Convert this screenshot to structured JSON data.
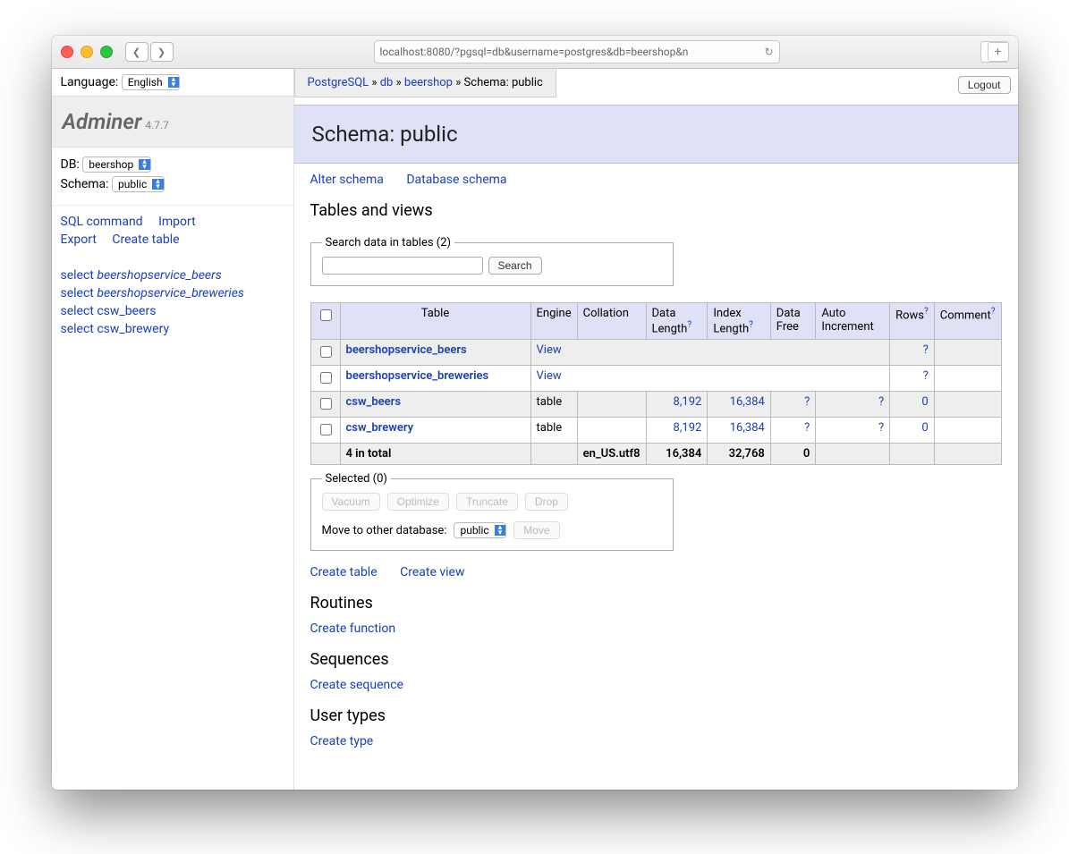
{
  "browser": {
    "url": "localhost:8080/?pgsql=db&username=postgres&db=beershop&n"
  },
  "sidebar": {
    "language_label": "Language:",
    "language_value": "English",
    "logo": "Adminer",
    "version": "4.7.7",
    "db_label": "DB:",
    "db_value": "beershop",
    "schema_label": "Schema:",
    "schema_value": "public",
    "links": {
      "sql": "SQL command",
      "import": "Import",
      "export": "Export",
      "create_table": "Create table"
    },
    "tablelinks": [
      {
        "pre": "select ",
        "name": "beershopservice_beers",
        "italic": true
      },
      {
        "pre": "select ",
        "name": "beershopservice_breweries",
        "italic": true
      },
      {
        "pre": "select ",
        "name": "csw_beers",
        "italic": false
      },
      {
        "pre": "select ",
        "name": "csw_brewery",
        "italic": false
      }
    ]
  },
  "breadcrumb": {
    "a": "PostgreSQL",
    "b": "db",
    "c": "beershop",
    "d": "Schema: public",
    "sep": "»"
  },
  "logout": "Logout",
  "heading": "Schema: public",
  "top_links": {
    "alter": "Alter schema",
    "dbschema": "Database schema"
  },
  "sections": {
    "tables_heading": "Tables and views",
    "search_legend": "Search data in tables (2)",
    "search_btn": "Search",
    "cols": {
      "table": "Table",
      "engine": "Engine",
      "collation": "Collation",
      "datalen": "Data Length",
      "indexlen": "Index Length",
      "datafree": "Data Free",
      "autoinc": "Auto Increment",
      "rows": "Rows",
      "comment": "Comment"
    },
    "rows": [
      {
        "name": "beershopservice_beers",
        "engine": "View",
        "isview": true,
        "rows": "?"
      },
      {
        "name": "beershopservice_breweries",
        "engine": "View",
        "isview": true,
        "rows": "?"
      },
      {
        "name": "csw_beers",
        "engine": "table",
        "datalen": "8,192",
        "indexlen": "16,384",
        "datafree": "?",
        "autoinc": "?",
        "rows": "0"
      },
      {
        "name": "csw_brewery",
        "engine": "table",
        "datalen": "8,192",
        "indexlen": "16,384",
        "datafree": "?",
        "autoinc": "?",
        "rows": "0"
      }
    ],
    "footer": {
      "label": "4 in total",
      "collation": "en_US.utf8",
      "datalen": "16,384",
      "indexlen": "32,768",
      "datafree": "0"
    },
    "selected_legend": "Selected (0)",
    "sel_btns": {
      "vacuum": "Vacuum",
      "optimize": "Optimize",
      "truncate": "Truncate",
      "drop": "Drop"
    },
    "move_label": "Move to other database:",
    "move_value": "public",
    "move_btn": "Move",
    "create_table": "Create table",
    "create_view": "Create view",
    "routines_h": "Routines",
    "create_function": "Create function",
    "sequences_h": "Sequences",
    "create_sequence": "Create sequence",
    "usertypes_h": "User types",
    "create_type": "Create type"
  }
}
